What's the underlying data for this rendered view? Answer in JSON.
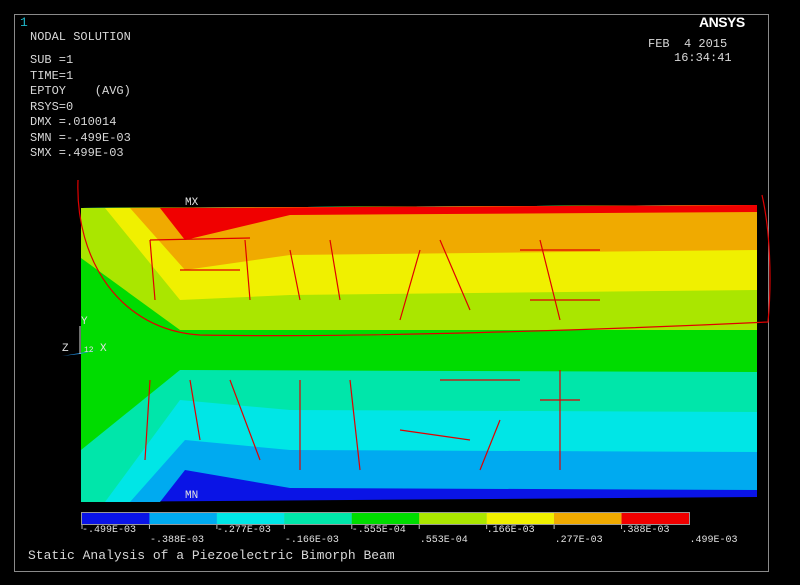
{
  "window_number": "1",
  "header": {
    "title": "NODAL SOLUTION",
    "lines": [
      "SUB =1",
      "TIME=1",
      "EPTOY    (AVG)",
      "RSYS=0",
      "DMX =.010014",
      "SMN =-.499E-03",
      "SMX =.499E-03"
    ]
  },
  "date": "FEB  4 2015",
  "time": "16:34:41",
  "logo": "ANSYS",
  "labels": {
    "mx": "MX",
    "mn": "MN",
    "axis_y": "Y",
    "axis_z": "Z",
    "axis_x": "X",
    "axis_num": "12"
  },
  "legend": {
    "colors": [
      "#0a14e6",
      "#00aaf0",
      "#00e6e6",
      "#00e6aa",
      "#00dc00",
      "#aae600",
      "#f0f000",
      "#f0aa00",
      "#f00000"
    ],
    "values_top": [
      "-.499E-03",
      "-.277E-03",
      "-.555E-04",
      ".166E-03",
      ".388E-03"
    ],
    "values_bottom": [
      "-.388E-03",
      "-.166E-03",
      ".553E-04",
      ".277E-03",
      ".499E-03"
    ]
  },
  "footer_title": "Static Analysis of a Piezoelectric Bimorph Beam"
}
